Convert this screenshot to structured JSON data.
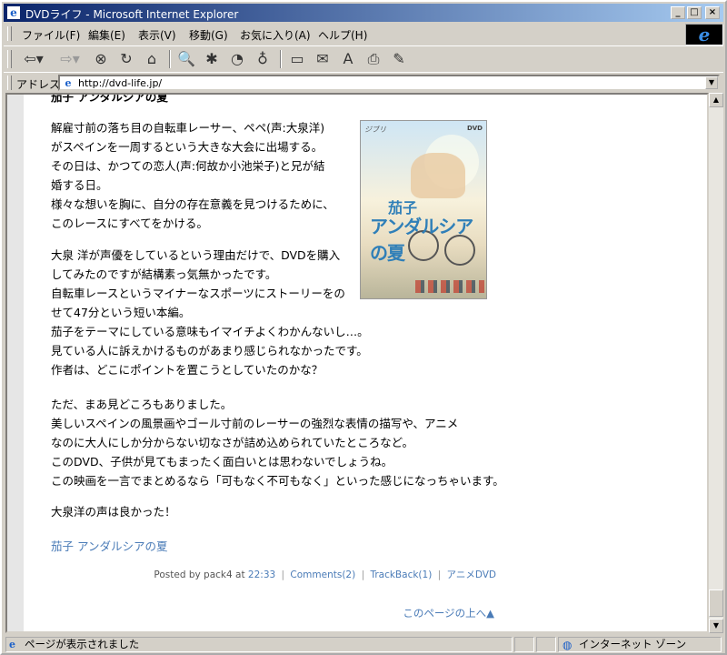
{
  "window": {
    "title": "DVDライフ - Microsoft Internet Explorer",
    "controls": [
      "_",
      "□",
      "×"
    ]
  },
  "menu": [
    "ファイル(F)",
    "編集(E)",
    "表示(V)",
    "移動(G)",
    "お気に入り(A)",
    "ヘルプ(H)"
  ],
  "address": {
    "label": "アドレス",
    "url": "http://dvd-life.jp/"
  },
  "post": {
    "title": "茄子 アンダルシアの夏",
    "paragraphs": [
      [
        "解雇寸前の落ち目の自転車レーサー、ペペ(声:大泉洋)",
        "がスペインを一周するという大きな大会に出場する。",
        "その日は、かつての恋人(声:何故か小池栄子)と兄が結",
        "婚する日。",
        "様々な想いを胸に、自分の存在意義を見つけるために、",
        "このレースにすべてをかける。"
      ],
      [
        "大泉 洋が声優をしているという理由だけで、DVDを購入",
        "してみたのですが結構素っ気無かったです。",
        "自転車レースというマイナーなスポーツにストーリーをの",
        "せて47分という短い本編。",
        "茄子をテーマにしている意味もイマイチよくわかんないし…。",
        "見ている人に訴えかけるものがあまり感じられなかったです。",
        "作者は、どこにポイントを置こうとしていたのかな？"
      ],
      [
        "ただ、まあ見どころもありました。",
        "美しいスペインの風景画やゴール寸前のレーサーの強烈な表情の描写や、アニメ",
        "なのに大人にしか分からない切なさが詰め込められていたところなど。",
        "このDVD、子供が見てもまったく面白いとは思わないでしょうね。",
        "この映画を一言でまとめるなら「可もなく不可もなく」といった感じになっちゃいます。"
      ],
      [
        "大泉洋の声は良かった！"
      ]
    ],
    "cover": {
      "title_line1": "茄子",
      "title_line2": "アンダルシアの夏",
      "dvd_mark": "DVD",
      "studio": "ジブリ"
    },
    "link_text": "茄子 アンダルシアの夏",
    "footer": {
      "posted_by": "Posted by pack4 at",
      "time": "22:33",
      "comments": "Comments(2)",
      "trackback": "TrackBack(1)",
      "category": "アニメDVD"
    },
    "page_top": "このページの上へ▲"
  },
  "status": {
    "text": "ページが表示されました",
    "zone": "インターネット ゾーン"
  }
}
